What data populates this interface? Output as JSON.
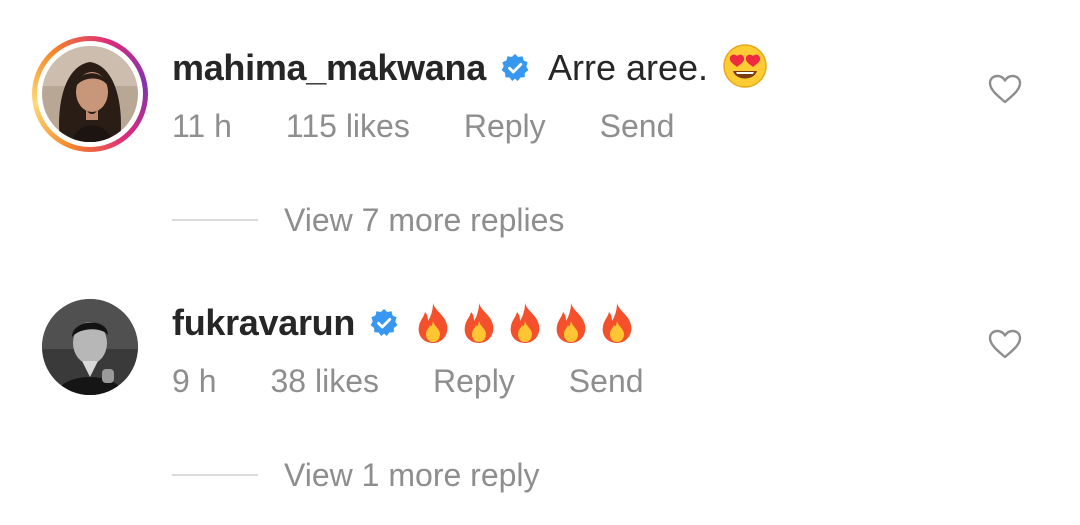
{
  "comments": [
    {
      "username": "mahima_makwana",
      "verified": true,
      "text": "Arre aree.",
      "emoji": "heart-eyes",
      "time": "11 h",
      "likes": "115 likes",
      "reply_label": "Reply",
      "send_label": "Send",
      "view_replies": "View 7 more replies",
      "has_story_ring": true
    },
    {
      "username": "fukravarun",
      "verified": true,
      "text": "",
      "emoji": "fire x5",
      "time": "9 h",
      "likes": "38 likes",
      "reply_label": "Reply",
      "send_label": "Send",
      "view_replies": "View 1 more reply",
      "has_story_ring": false
    }
  ],
  "colors": {
    "text_primary": "#262626",
    "text_secondary": "#8e8e8e",
    "verified_blue": "#3897f0",
    "divider": "#dbdbdb"
  },
  "icons": [
    "verified-badge-icon",
    "heart-outline-icon",
    "heart-eyes-emoji",
    "fire-emoji"
  ]
}
